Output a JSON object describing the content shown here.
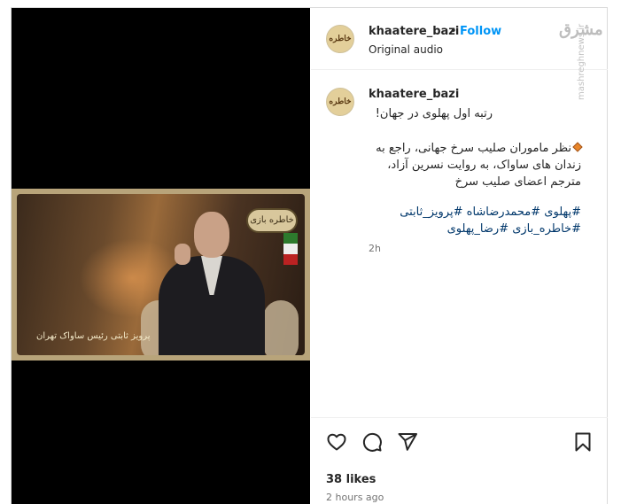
{
  "post": {
    "username": "khaatere_bazi",
    "avatar_text": "خاطره",
    "separator": "•",
    "follow_label": "Follow",
    "audio_label": "Original audio",
    "video": {
      "caption": "پرویز ثابتی رئیس ساواک تهران",
      "badge_text": "خاطره بازی"
    }
  },
  "watermark": {
    "logo_text": "مشرق",
    "url": "mashreghnews.ir"
  },
  "caption": {
    "username": "khaatere_bazi",
    "username_suffix": ".",
    "title": "رتبه اول پهلوی در جهان!",
    "body": "نظر ماموران صلیب سرخ جهانی، راجع به زندان های ساواک، به روایت نسرین آزاد، مترجم اعضای صلیب سرخ",
    "hashtags": "#پهلوی #محمدرضاشاه #پرویز_ثابتی #خاطره_بازی #رضا_پهلوی",
    "time": "2h"
  },
  "actions": {
    "like_icon": "heart-icon",
    "comment_icon": "comment-icon",
    "share_icon": "send-icon",
    "save_icon": "bookmark-icon",
    "likes": "38 likes",
    "posted": "2 hours ago"
  }
}
